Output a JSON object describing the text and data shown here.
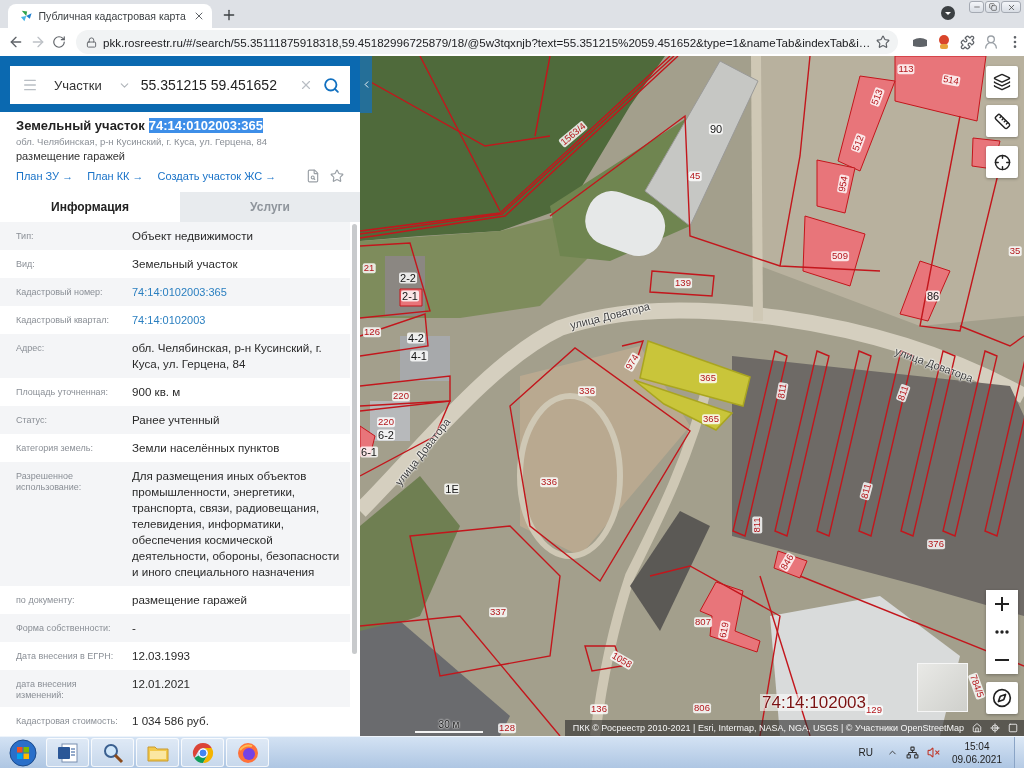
{
  "browser": {
    "tab_title": "Публичная кадастровая карта",
    "url": "pkk.rosreestr.ru/#/search/55.35111875918318,59.45182996725879/18/@5w3tqxnjb?text=55.351215%2059.451652&type=1&nameTab&indexTab&i…",
    "forward_disabled": true
  },
  "search": {
    "category": "Участки",
    "value": "55.351215 59.451652"
  },
  "object": {
    "type": "Земельный участок",
    "number": "74:14:0102003:365",
    "number_selected": true,
    "address": "обл. Челябинская, р-н Кусинский, г. Куса, ул. Герцена, 84",
    "use": "размещение гаражей",
    "links": [
      "План ЗУ →",
      "План КК →",
      "Создать участок ЖС →"
    ]
  },
  "tabs": [
    {
      "label": "Информация",
      "selected": true
    },
    {
      "label": "Услуги",
      "selected": false
    }
  ],
  "properties": [
    {
      "label": "Тип:",
      "value": "Объект недвижимости",
      "kind": "text"
    },
    {
      "label": "Вид:",
      "value": "Земельный участок",
      "kind": "text"
    },
    {
      "label": "Кадастровый номер:",
      "value": "74:14:0102003:365",
      "kind": "link"
    },
    {
      "label": "Кадастровый квартал:",
      "value": "74:14:0102003",
      "kind": "link"
    },
    {
      "label": "Адрес:",
      "value": "обл. Челябинская, р-н Кусинский, г. Куса, ул. Герцена, 84",
      "kind": "text"
    },
    {
      "label": "Площадь уточненная:",
      "value": "900 кв. м",
      "kind": "text"
    },
    {
      "label": "Статус:",
      "value": "Ранее учтенный",
      "kind": "text"
    },
    {
      "label": "Категория земель:",
      "value": "Земли населённых пунктов",
      "kind": "text"
    },
    {
      "label": "Разрешенное использование:",
      "value": "Для размещения иных объектов промышленности, энергетики, транспорта, связи, радиовещания, телевидения, информатики, обеспечения космической деятельности, обороны, безопасности и иного специального назначения",
      "kind": "text"
    },
    {
      "label": "по документу:",
      "value": "размещение гаражей",
      "kind": "text"
    },
    {
      "label": "Форма собственности:",
      "value": "-",
      "kind": "text"
    },
    {
      "label": "Дата внесения в ЕГРН:",
      "value": "12.03.1993",
      "kind": "text"
    },
    {
      "label": "дата внесения изменений:",
      "value": "12.01.2021",
      "kind": "text"
    },
    {
      "label": "Кадастровая стоимость:",
      "value": "1 034 586 руб.",
      "kind": "text"
    }
  ],
  "map": {
    "labels": [
      {
        "text": "113",
        "kind": "parcel"
      },
      {
        "text": "514",
        "kind": "parcel"
      },
      {
        "text": "513",
        "kind": "parcel"
      },
      {
        "text": "512",
        "kind": "parcel"
      },
      {
        "text": "90",
        "kind": "building"
      },
      {
        "text": "45",
        "kind": "parcel"
      },
      {
        "text": "1563/4",
        "kind": "parcel"
      },
      {
        "text": "954",
        "kind": "parcel"
      },
      {
        "text": "509",
        "kind": "parcel"
      },
      {
        "text": "86",
        "kind": "building"
      },
      {
        "text": "139",
        "kind": "parcel"
      },
      {
        "text": "21",
        "kind": "parcel"
      },
      {
        "text": "2-2",
        "kind": "building"
      },
      {
        "text": "2-1",
        "kind": "building"
      },
      {
        "text": "126",
        "kind": "parcel"
      },
      {
        "text": "4-2",
        "kind": "building"
      },
      {
        "text": "4-1",
        "kind": "building"
      },
      {
        "text": "220",
        "kind": "parcel"
      },
      {
        "text": "220",
        "kind": "parcel"
      },
      {
        "text": "6-2",
        "kind": "building"
      },
      {
        "text": "6-1",
        "kind": "building"
      },
      {
        "text": "974",
        "kind": "parcel"
      },
      {
        "text": "365",
        "kind": "parcel"
      },
      {
        "text": "365",
        "kind": "parcel"
      },
      {
        "text": "336",
        "kind": "parcel"
      },
      {
        "text": "336",
        "kind": "parcel"
      },
      {
        "text": "811",
        "kind": "parcel"
      },
      {
        "text": "811",
        "kind": "parcel"
      },
      {
        "text": "811",
        "kind": "parcel"
      },
      {
        "text": "811",
        "kind": "parcel"
      },
      {
        "text": "376",
        "kind": "parcel"
      },
      {
        "text": "846",
        "kind": "parcel"
      },
      {
        "text": "807",
        "kind": "parcel"
      },
      {
        "text": "619",
        "kind": "parcel"
      },
      {
        "text": "337",
        "kind": "parcel"
      },
      {
        "text": "1058",
        "kind": "parcel"
      },
      {
        "text": "136",
        "kind": "parcel"
      },
      {
        "text": "806",
        "kind": "parcel"
      },
      {
        "text": "129",
        "kind": "parcel"
      },
      {
        "text": "128",
        "kind": "parcel"
      },
      {
        "text": "784/5",
        "kind": "parcel"
      },
      {
        "text": "35",
        "kind": "parcel"
      },
      {
        "text": "1E",
        "kind": "building"
      }
    ],
    "streets": [
      "улица Доватора",
      "улица Доватора",
      "улица Доватора"
    ],
    "quarter": "74:14:102003",
    "scale": "30 м",
    "attribution": "ПКК © Росреестр 2010-2021 | Esri, Intermap, NASA, NGA, USGS | © Участники OpenStreetMap"
  },
  "taskbar": {
    "language": "RU",
    "time": "15:04",
    "date": "09.06.2021"
  }
}
